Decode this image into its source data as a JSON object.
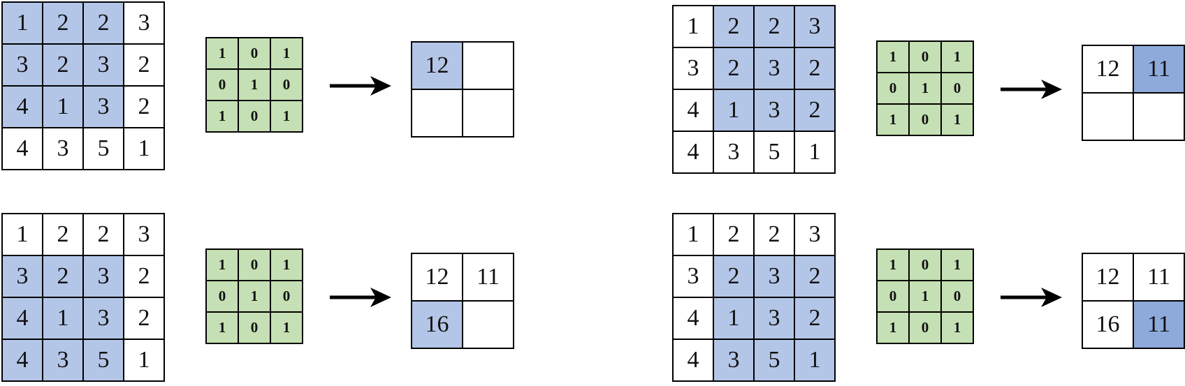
{
  "colors": {
    "window_highlight": "#b4c6e7",
    "kernel_fill": "#c5e0b4",
    "new_output_current": "#b4c6e7",
    "new_output_strong": "#8eaadb",
    "background": "#ffffff",
    "line": "#000000"
  },
  "input_matrix": [
    [
      "1",
      "2",
      "2",
      "3"
    ],
    [
      "3",
      "2",
      "3",
      "2"
    ],
    [
      "4",
      "1",
      "3",
      "2"
    ],
    [
      "4",
      "3",
      "5",
      "1"
    ]
  ],
  "kernel_matrix": [
    [
      "1",
      "0",
      "1"
    ],
    [
      "0",
      "1",
      "0"
    ],
    [
      "1",
      "0",
      "1"
    ]
  ],
  "panels": [
    {
      "window_row": 0,
      "window_col": 0,
      "output": [
        [
          "12",
          ""
        ],
        [
          "",
          ""
        ]
      ],
      "highlight_row": 0,
      "highlight_col": 0,
      "highlight_color": "#b4c6e7"
    },
    {
      "window_row": 0,
      "window_col": 1,
      "output": [
        [
          "12",
          "11"
        ],
        [
          "",
          ""
        ]
      ],
      "highlight_row": 0,
      "highlight_col": 1,
      "highlight_color": "#8eaadb"
    },
    {
      "window_row": 1,
      "window_col": 0,
      "output": [
        [
          "12",
          "11"
        ],
        [
          "16",
          ""
        ]
      ],
      "highlight_row": 1,
      "highlight_col": 0,
      "highlight_color": "#b4c6e7"
    },
    {
      "window_row": 1,
      "window_col": 1,
      "output": [
        [
          "12",
          "11"
        ],
        [
          "16",
          "11"
        ]
      ],
      "highlight_row": 1,
      "highlight_col": 1,
      "highlight_color": "#8eaadb"
    }
  ]
}
